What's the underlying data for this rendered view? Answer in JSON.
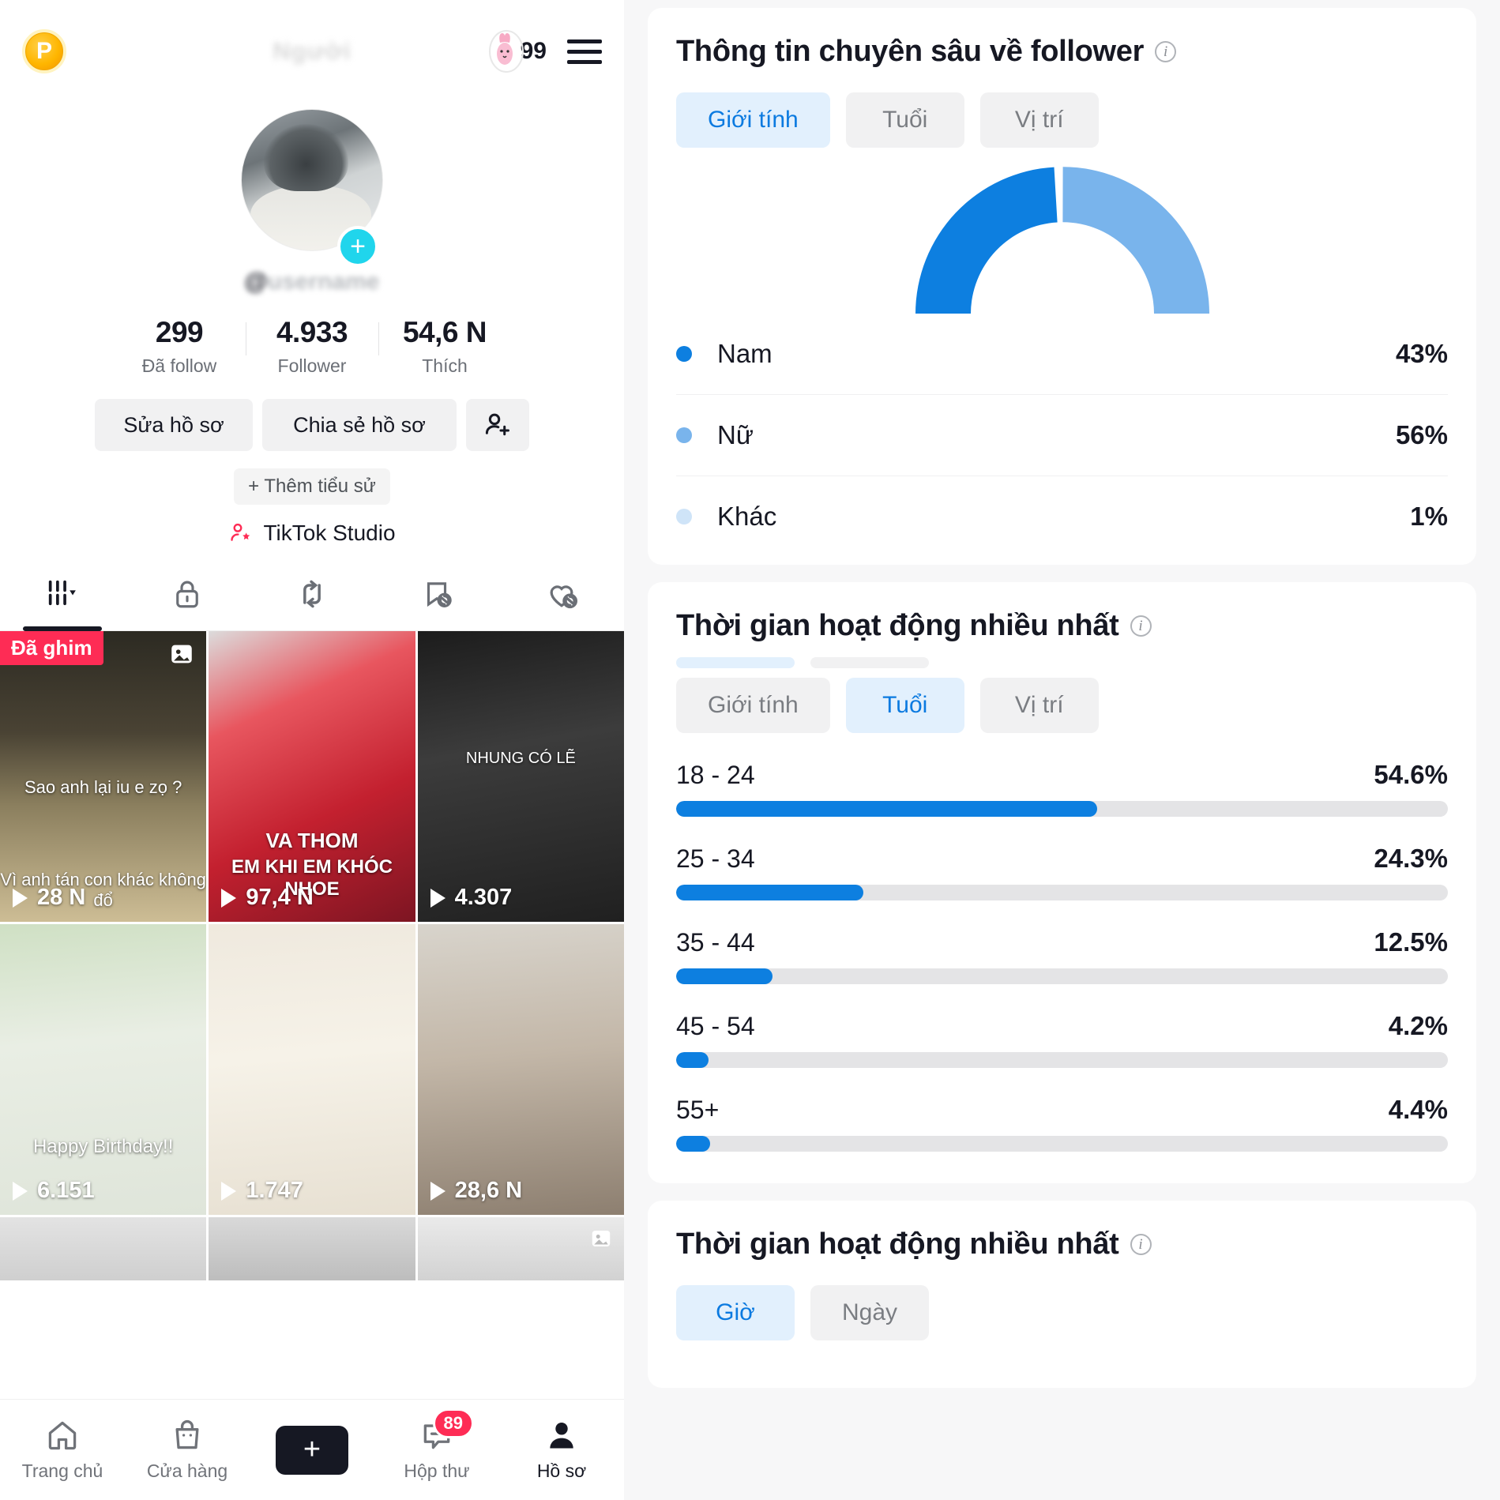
{
  "profile": {
    "coin_badge": "P",
    "title_blurred": "Người",
    "bunny_count": "99",
    "handle_at": "@",
    "handle_blurred": "username",
    "stats": [
      {
        "num": "299",
        "label": "Đã follow"
      },
      {
        "num": "4.933",
        "label": "Follower"
      },
      {
        "num": "54,6 N",
        "label": "Thích"
      }
    ],
    "edit_profile_label": "Sửa hồ sơ",
    "share_profile_label": "Chia sẻ hồ sơ",
    "add_friend_icon": "add-person-icon",
    "add_bio_label": "+ Thêm tiểu sử",
    "studio_label": "TikTok Studio",
    "tabs": [
      {
        "icon": "grid-posts-icon",
        "active": true
      },
      {
        "icon": "lock-private-icon",
        "active": false
      },
      {
        "icon": "repost-icon",
        "active": false
      },
      {
        "icon": "saved-hidden-icon",
        "active": false
      },
      {
        "icon": "liked-hidden-icon",
        "active": false
      }
    ],
    "videos": [
      {
        "views": "28 N",
        "pinned_label": "Đã ghim",
        "photo_badge": true,
        "caption": "Sao anh lại iu e zọ ?",
        "caption2": "Vì anh tán con khác không đổ"
      },
      {
        "views": "97,4 N",
        "caption": "VA THOM",
        "caption2": "EM KHI EM KHÓC NHOE"
      },
      {
        "views": "4.307",
        "caption": "NHUNG CÓ LẼ",
        "caption2": ""
      },
      {
        "views": "6.151",
        "caption": "Happy Birthday!!",
        "caption2": ""
      },
      {
        "views": "1.747",
        "caption": "",
        "caption2": ""
      },
      {
        "views": "28,6 N",
        "caption": "",
        "caption2": ""
      }
    ],
    "bottom_nav": [
      {
        "label": "Trang chủ",
        "icon": "home-icon",
        "active": false
      },
      {
        "label": "Cửa hàng",
        "icon": "shop-bag-icon",
        "active": false
      },
      {
        "label": "",
        "icon": "create-plus-icon",
        "active": false
      },
      {
        "label": "Hộp thư",
        "icon": "inbox-message-icon",
        "badge": "89",
        "active": false
      },
      {
        "label": "Hồ sơ",
        "icon": "profile-person-icon",
        "active": true
      }
    ]
  },
  "analytics": {
    "follower_insights": {
      "title": "Thông tin chuyên sâu về follower",
      "info_icon": "info-icon",
      "segments": [
        {
          "label": "Giới tính",
          "active": true
        },
        {
          "label": "Tuổi",
          "active": false
        },
        {
          "label": "Vị trí",
          "active": false
        }
      ]
    },
    "age_card": {
      "title": "Thời gian hoạt động nhiều nhất",
      "info_icon": "info-icon",
      "segments": [
        {
          "label": "Giới tính",
          "active": false
        },
        {
          "label": "Tuổi",
          "active": true
        },
        {
          "label": "Vị trí",
          "active": false
        }
      ]
    },
    "time_card": {
      "title": "Thời gian hoạt động nhiều nhất",
      "info_icon": "info-icon",
      "segments": [
        {
          "label": "Giờ",
          "active": true
        },
        {
          "label": "Ngày",
          "active": false
        }
      ]
    }
  },
  "colors": {
    "blue_dark": "#0d7fe0",
    "blue_light": "#79b4ec",
    "blue_pale": "#b9d9f7",
    "accent_red": "#fe2c55",
    "accent_cyan": "#25f4ee",
    "track_grey": "#e4e4e6"
  },
  "chart_data": [
    {
      "type": "pie",
      "title": "Thông tin chuyên sâu về follower",
      "subtitle": "Giới tính",
      "style": "half-donut-gauge",
      "legend_position": "below",
      "labels": [
        "Nam",
        "Nữ",
        "Khác"
      ],
      "values": [
        43,
        56,
        1
      ],
      "display_values": [
        "43%",
        "56%",
        "1%"
      ],
      "colors": [
        "#0d7fe0",
        "#79b4ec",
        "#b9d9f7"
      ]
    },
    {
      "type": "bar",
      "orientation": "horizontal",
      "title": "Thời gian hoạt động nhiều nhất",
      "subtitle": "Tuổi",
      "xlabel": "",
      "ylabel": "",
      "xlim": [
        0,
        100
      ],
      "grid": false,
      "categories": [
        "18 - 24",
        "25 - 34",
        "35 - 44",
        "45 - 54",
        "55+"
      ],
      "values": [
        54.6,
        24.3,
        12.5,
        4.2,
        4.4
      ],
      "display_values": [
        "54.6%",
        "24.3%",
        "12.5%",
        "4.2%",
        "4.4%"
      ],
      "bar_color": "#0d7fe0",
      "track_color": "#e4e4e6"
    }
  ]
}
